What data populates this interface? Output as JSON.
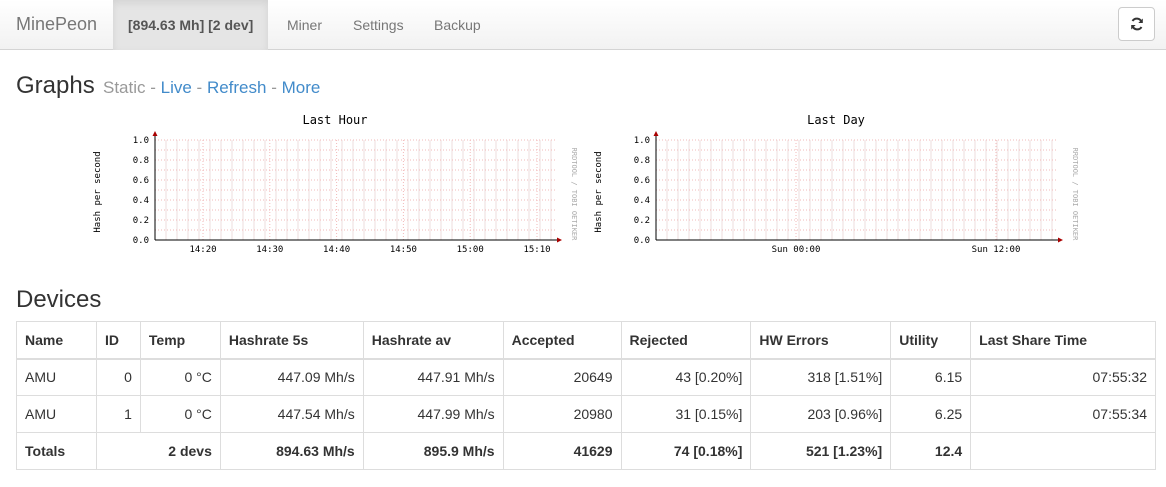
{
  "navbar": {
    "brand": "MinePeon",
    "status": "[894.63 Mh] [2 dev]",
    "items": [
      "Miner",
      "Settings",
      "Backup"
    ]
  },
  "graphs": {
    "heading": "Graphs",
    "static": "Static",
    "sep": " - ",
    "live": "Live",
    "refresh": "Refresh",
    "more": "More"
  },
  "chart_data": [
    {
      "type": "line",
      "title": "Last Hour",
      "ylabel": "Hash per second",
      "watermark": "RRDTOOL / TOBI OETIKER",
      "yticks": [
        "1.0",
        "0.8",
        "0.6",
        "0.4",
        "0.2",
        "0.0"
      ],
      "xticks": [
        "14:20",
        "14:30",
        "14:40",
        "14:50",
        "15:00",
        "15:10"
      ],
      "ylim": [
        0,
        1.0
      ],
      "series": []
    },
    {
      "type": "line",
      "title": "Last Day",
      "ylabel": "Hash per second",
      "watermark": "RRDTOOL / TOBI OETIKER",
      "yticks": [
        "1.0",
        "0.8",
        "0.6",
        "0.4",
        "0.2",
        "0.0"
      ],
      "xticks": [
        "Sun 00:00",
        "Sun 12:00"
      ],
      "ylim": [
        0,
        1.0
      ],
      "series": []
    }
  ],
  "devices": {
    "heading": "Devices",
    "columns": [
      "Name",
      "ID",
      "Temp",
      "Hashrate 5s",
      "Hashrate av",
      "Accepted",
      "Rejected",
      "HW Errors",
      "Utility",
      "Last Share Time"
    ],
    "rows": [
      [
        "AMU",
        "0",
        "0 °C",
        "447.09 Mh/s",
        "447.91 Mh/s",
        "20649",
        "43 [0.20%]",
        "318 [1.51%]",
        "6.15",
        "07:55:32"
      ],
      [
        "AMU",
        "1",
        "0 °C",
        "447.54 Mh/s",
        "447.99 Mh/s",
        "20980",
        "31 [0.15%]",
        "203 [0.96%]",
        "6.25",
        "07:55:34"
      ]
    ],
    "totals": [
      "Totals",
      "2 devs",
      "894.63 Mh/s",
      "895.9 Mh/s",
      "41629",
      "74 [0.18%]",
      "521 [1.23%]",
      "12.4",
      ""
    ]
  }
}
